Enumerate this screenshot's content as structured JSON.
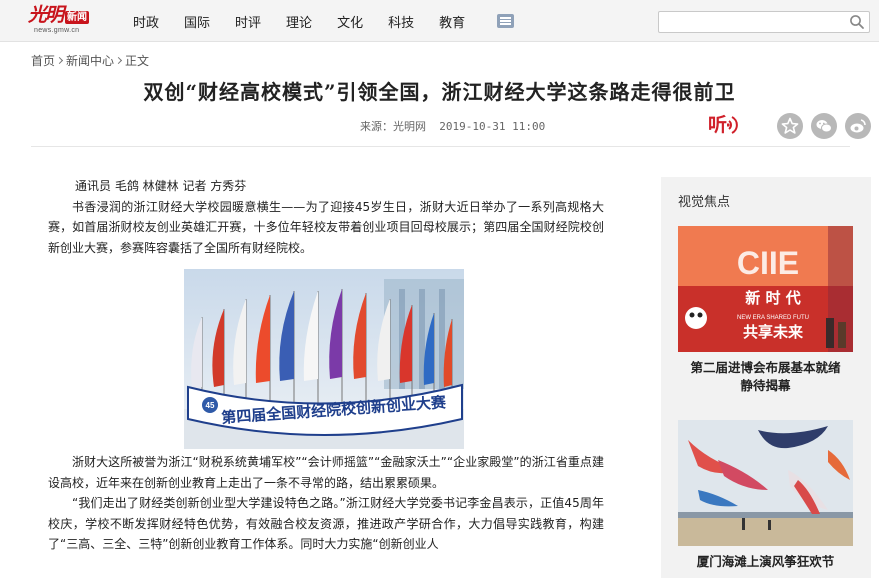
{
  "header": {
    "logo_main": "光明",
    "logo_news": "新闻",
    "logo_url": "news.gmw.cn",
    "nav": [
      "时政",
      "国际",
      "时评",
      "理论",
      "文化",
      "科技",
      "教育"
    ],
    "menu_icon": "list-menu-icon",
    "search": {
      "value": "",
      "placeholder": "",
      "icon": "search-icon"
    }
  },
  "breadcrumb": {
    "items": [
      "首页",
      "新闻中心",
      "正文"
    ]
  },
  "article": {
    "title": "双创“财经高校模式”引领全国，浙江财经大学这条路走得很前卫",
    "source_label": "来源：",
    "source": "光明网",
    "datetime": "2019-10-31 11:00",
    "listen_label": "听",
    "share_icons": [
      "star-icon",
      "wechat-icon",
      "weibo-icon"
    ],
    "byline": "通讯员 毛鸽 林健林 记者 方秀芬",
    "paragraphs": [
      "书香浸润的浙江财经大学校园暖意横生——为了迎接45岁生日，浙财大近日举办了一系列高规格大赛，如首届浙财校友创业英雄汇开赛，十多位年轻校友带着创业项目回母校展示；第四届全国财经院校创新创业大赛，参赛阵容囊括了全国所有财经院校。",
      "浙财大这所被誉为浙江“财税系统黄埔军校”“会计师摇篮”“金融家沃土”“企业家殿堂”的浙江省重点建设高校，近年来在创新创业教育上走出了一条不寻常的路，结出累累硕果。",
      "“我们走出了财经类创新创业型大学建设特色之路。”浙江财经大学党委书记李金昌表示，正值45周年校庆，学校不断发挥财经特色优势，有效融合校友资源，推进政产学研合作，大力倡导实践教育，构建了“三高、三全、三特”创新创业教育工作体系。同时大力实施“创新创业人"
    ],
    "image_banner_text": "第四届全国财经院校创新创业大赛",
    "image_badge": "45"
  },
  "sidebar": {
    "title": "视觉焦点",
    "items": [
      {
        "caption_line1": "第二届进博会布展基本就绪",
        "caption_line2": "静待揭幕",
        "sign_title": "CIIE",
        "sign_line1": "新 时 代",
        "sign_line2": "共享未来",
        "sign_en": "NEW ERA SHARED FUTU"
      },
      {
        "caption_line1": "厦门海滩上演风筝狂欢节",
        "caption_line2": ""
      }
    ]
  },
  "colors": {
    "brand_red": "#c8141c",
    "sidebar_bg": "#f2f2f2",
    "topbar_bg": "#f4f4f4"
  }
}
